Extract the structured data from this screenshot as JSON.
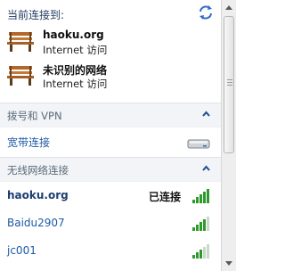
{
  "header": {
    "title": "当前连接到:",
    "refresh_icon": "refresh-arrows-icon"
  },
  "current_connections": [
    {
      "name": "haoku.org",
      "status": "Internet 访问",
      "icon": "network-bench-icon"
    },
    {
      "name": "未识别的网络",
      "status": "Internet 访问",
      "icon": "network-bench-icon"
    }
  ],
  "dialup_section": {
    "label": "拨号和 VPN",
    "icon": "chevron-up-icon"
  },
  "broadband": {
    "name": "宽带连接",
    "icon": "broadband-drive-icon"
  },
  "wireless_section": {
    "label": "无线网络连接",
    "icon": "chevron-up-icon"
  },
  "wireless_networks": [
    {
      "name": "haoku.org",
      "status": "已连接",
      "icon": "signal-strength-icon"
    },
    {
      "name": "Baidu2907",
      "status": "",
      "icon": "signal-strength-icon"
    },
    {
      "name": "jc001",
      "status": "",
      "icon": "signal-strength-icon"
    }
  ],
  "colors": {
    "link": "#1f5aa6",
    "section_bg": "#f2f4f7",
    "signal_green": "#2e9a2e"
  }
}
